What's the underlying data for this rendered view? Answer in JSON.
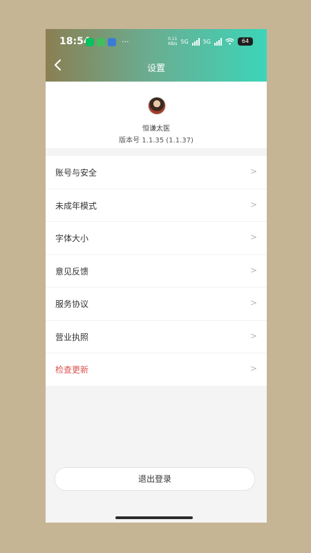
{
  "status_bar": {
    "time": "18:54",
    "app_icons": [
      {
        "name": "wechat-icon",
        "color": "#07c160"
      },
      {
        "name": "chat-icon",
        "color": "#3fbf5f"
      },
      {
        "name": "app-icon",
        "color": "#3a7bd5"
      }
    ],
    "more": "···",
    "net_speed_value": "0.11",
    "net_speed_unit": "KB/s",
    "network_1": "5G",
    "network_2": "5G",
    "battery": "64"
  },
  "header": {
    "title": "设置",
    "gradient_start": "#8a7f52",
    "gradient_end": "#3cd5b9"
  },
  "profile": {
    "username": "恒谦太医",
    "version": "版本号 1.1.35 (1.1.37)"
  },
  "menu": {
    "items": [
      {
        "label": "账号与安全",
        "arrow": ">"
      },
      {
        "label": "未成年模式",
        "arrow": ">"
      },
      {
        "label": "字体大小",
        "arrow": ">"
      },
      {
        "label": "意见反馈",
        "arrow": ">"
      },
      {
        "label": "服务协议",
        "arrow": ">"
      },
      {
        "label": "营业执照",
        "arrow": ">"
      },
      {
        "label": "检查更新",
        "arrow": ">",
        "color": "#d9534f"
      }
    ]
  },
  "logout": {
    "label": "退出登录"
  }
}
